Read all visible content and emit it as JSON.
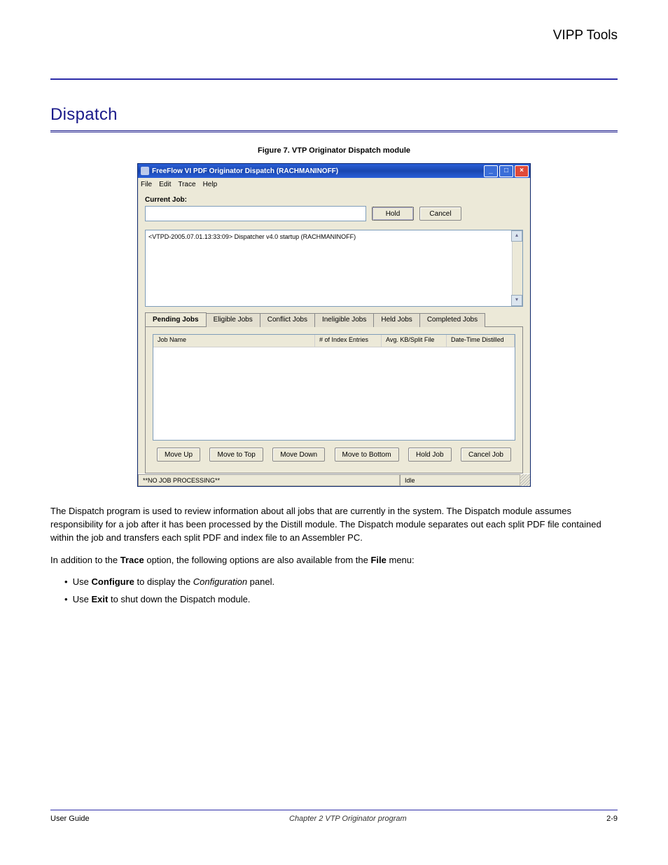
{
  "doc": {
    "header_right": "VIPP Tools",
    "section_title": "Dispatch",
    "figure_caption": "Figure 7. VTP Originator Dispatch module"
  },
  "window": {
    "title": "FreeFlow VI PDF Originator Dispatch (RACHMANINOFF)",
    "menu": {
      "file": "File",
      "edit": "Edit",
      "trace": "Trace",
      "help": "Help"
    },
    "current_job_label": "Current Job:",
    "current_job_value": "",
    "btn_hold": "Hold",
    "btn_cancel": "Cancel",
    "log_line": "<VTPD-2005.07.01.13:33:09> Dispatcher v4.0 startup (RACHMANINOFF)",
    "tabs": {
      "pending": "Pending Jobs",
      "eligible": "Eligible Jobs",
      "conflict": "Conflict Jobs",
      "ineligible": "Ineligible Jobs",
      "held": "Held Jobs",
      "completed": "Completed Jobs"
    },
    "columns": {
      "job_name": "Job Name",
      "index_entries": "# of Index Entries",
      "avg_kb": "Avg. KB/Split File",
      "distilled": "Date-Time Distilled"
    },
    "buttons": {
      "move_up": "Move Up",
      "move_top": "Move to Top",
      "move_down": "Move Down",
      "move_bottom": "Move to Bottom",
      "hold_job": "Hold Job",
      "cancel_job": "Cancel Job"
    },
    "status_left": "**NO JOB PROCESSING**",
    "status_right": "Idle"
  },
  "body_text": {
    "p1": "The Dispatch program is used to review information about all jobs that are currently in the system. The Dispatch module assumes responsibility for a job after it has been processed by the Distill module. The Dispatch module separates out each split PDF file contained within the job and transfers each split PDF and index file to an Assembler PC.",
    "p2_a": "In addition to the ",
    "p2_b": " option, the following options are also available from the ",
    "p2_c": " menu:",
    "file_bold": "File",
    "trace_bold": "Trace",
    "bullets": {
      "b1a": "Use ",
      "b1b": " to display the ",
      "b1c": " panel.",
      "configure": "Configure ",
      "config_panel": "Configuration",
      "b2a": "Use ",
      "b2b": " to shut down the Dispatch module.",
      "exit": "Exit"
    }
  },
  "footer": {
    "left": "User Guide",
    "mid": "Chapter 2  VTP Originator program",
    "right": "2-9"
  }
}
